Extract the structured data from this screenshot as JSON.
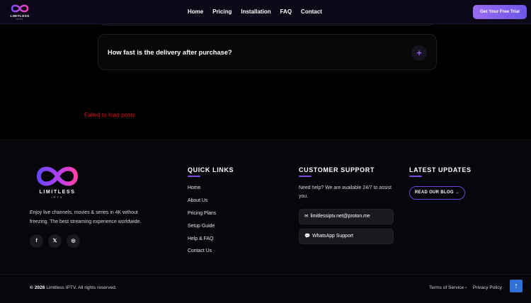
{
  "header": {
    "logo_text": "LIMITLESS",
    "logo_sub": "IPTV",
    "nav": [
      "Home",
      "Pricing",
      "Installation",
      "FAQ",
      "Contact"
    ],
    "cta_label": "Get Your Free Trial"
  },
  "faq": {
    "question": "How fast is the delivery after purchase?",
    "toggle_symbol": "+"
  },
  "posts": {
    "error": "Failed to load posts"
  },
  "footer": {
    "brand": {
      "name": "LIMITLESS",
      "sub": "IPTV",
      "tagline": "Enjoy live channels, movies & series in 4K without freezing. The best streaming experience worldwide."
    },
    "social": [
      {
        "icon": "facebook-icon",
        "glyph": "f"
      },
      {
        "icon": "x-twitter-icon",
        "glyph": "𝕏"
      },
      {
        "icon": "instagram-icon",
        "glyph": "◎"
      }
    ],
    "quick_links": {
      "title": "QUICK LINKS",
      "items": [
        "Home",
        "About Us",
        "Pricing Plans",
        "Setup Guide",
        "Help & FAQ",
        "Contact Us"
      ]
    },
    "support": {
      "title": "CUSTOMER SUPPORT",
      "text": "Need help? We are available 24/7 to assist you.",
      "email_icon": "✉",
      "email": "limitlessiptv.net@proton.me",
      "whatsapp_icon": "💬",
      "whatsapp": "WhatsApp Support"
    },
    "updates": {
      "title": "LATEST UPDATES",
      "blog_label": "READ OUR BLOG →"
    },
    "bottom": {
      "year": "© 2026",
      "copyright": "Limitless IPTV. All rights reserved.",
      "terms": "Terms of Service",
      "separator": "•",
      "privacy": "Privacy Policy",
      "to_top": "↑"
    }
  },
  "colors": {
    "accent": "#7b4de6",
    "cta_start": "#9a6bf2",
    "cta_end": "#6d56e6",
    "error": "#e01212",
    "to_top": "#2f6fd8"
  }
}
